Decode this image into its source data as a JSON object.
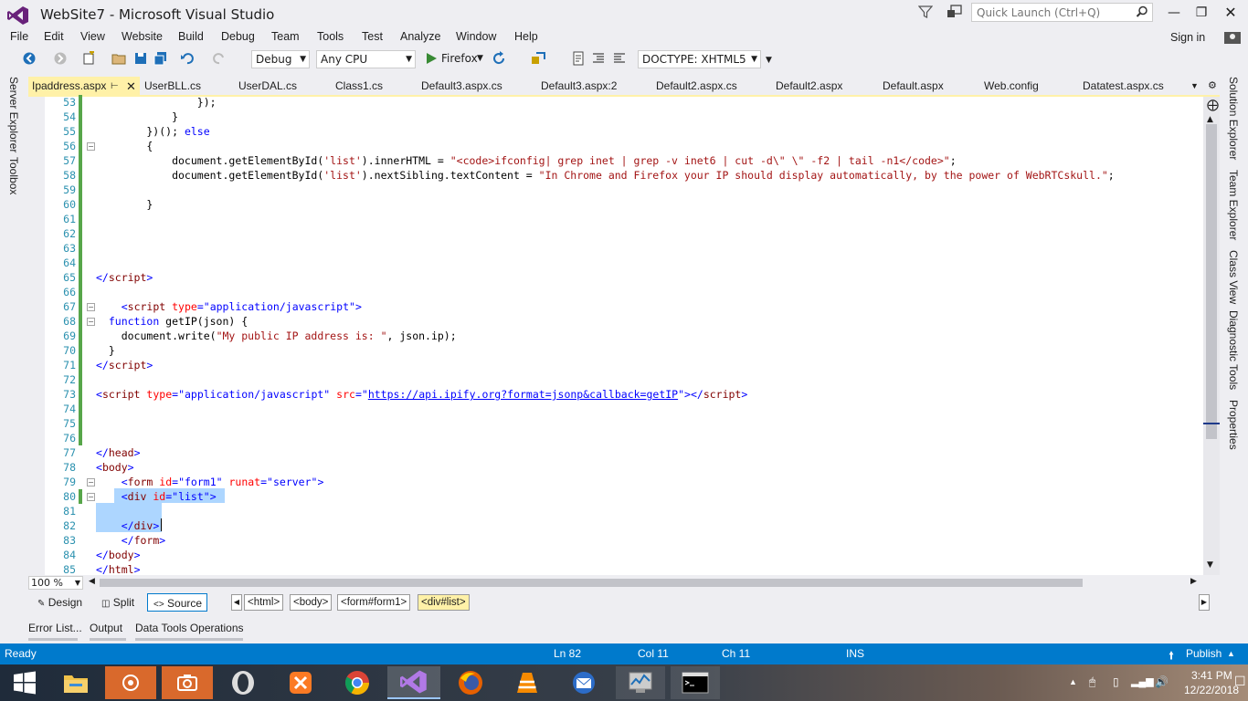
{
  "window": {
    "title": "WebSite7 - Microsoft Visual Studio"
  },
  "quick_launch": {
    "placeholder": "Quick Launch (Ctrl+Q)"
  },
  "menu": {
    "items": [
      "File",
      "Edit",
      "View",
      "Website",
      "Build",
      "Debug",
      "Team",
      "Tools",
      "Test",
      "Analyze",
      "Window",
      "Help"
    ],
    "sign_in": "Sign in"
  },
  "toolbar": {
    "config": "Debug",
    "platform": "Any CPU",
    "run_target": "Firefox",
    "doctype": "DOCTYPE: XHTML5"
  },
  "left_rail": [
    "Server Explorer",
    "Toolbox"
  ],
  "right_rail": [
    "Solution Explorer",
    "Team Explorer",
    "Class View",
    "Diagnostic Tools",
    "Properties"
  ],
  "tabs": [
    "Ipaddress.aspx",
    "UserBLL.cs",
    "UserDAL.cs",
    "Class1.cs",
    "Default3.aspx.cs",
    "Default3.aspx:2",
    "Default2.aspx.cs",
    "Default2.aspx",
    "Default.aspx",
    "Web.config",
    "Datatest.aspx.cs"
  ],
  "code_lines": [
    {
      "n": "53",
      "parts": [
        [
          "",
          "                });"
        ]
      ]
    },
    {
      "n": "54",
      "parts": [
        [
          "",
          "            }"
        ]
      ]
    },
    {
      "n": "55",
      "parts": [
        [
          "",
          "        })(); "
        ],
        [
          "k",
          "else"
        ]
      ]
    },
    {
      "n": "56",
      "parts": [
        [
          "",
          "        {"
        ]
      ]
    },
    {
      "n": "57",
      "parts": [
        [
          "",
          "            document.getElementById("
        ],
        [
          "s",
          "'list'"
        ],
        [
          "",
          ").innerHTML = "
        ],
        [
          "s",
          "\"<code>ifconfig| grep inet | grep -v inet6 | cut -d\\\" \\\" -f2 | tail -n1</code>\""
        ],
        [
          "",
          ";"
        ]
      ]
    },
    {
      "n": "58",
      "parts": [
        [
          "",
          "            document.getElementById("
        ],
        [
          "s",
          "'list'"
        ],
        [
          "",
          ").nextSibling.textContent = "
        ],
        [
          "s",
          "\"In Chrome and Firefox your IP should display automatically, by the power of WebRTCskull.\""
        ],
        [
          "",
          ";"
        ]
      ]
    },
    {
      "n": "59",
      "parts": [
        [
          "",
          ""
        ]
      ]
    },
    {
      "n": "60",
      "parts": [
        [
          "",
          "        }"
        ]
      ]
    },
    {
      "n": "61",
      "parts": [
        [
          "",
          ""
        ]
      ]
    },
    {
      "n": "62",
      "parts": [
        [
          "",
          ""
        ]
      ]
    },
    {
      "n": "63",
      "parts": [
        [
          "",
          ""
        ]
      ]
    },
    {
      "n": "64",
      "parts": [
        [
          "",
          ""
        ]
      ]
    },
    {
      "n": "65",
      "parts": [
        [
          "k",
          "</"
        ],
        [
          "t",
          "script"
        ],
        [
          "k",
          ">"
        ]
      ]
    },
    {
      "n": "66",
      "parts": [
        [
          "",
          ""
        ]
      ]
    },
    {
      "n": "67",
      "parts": [
        [
          "",
          "    "
        ],
        [
          "k",
          "<"
        ],
        [
          "t",
          "script"
        ],
        [
          "",
          " "
        ],
        [
          "a",
          "type"
        ],
        [
          "k",
          "="
        ],
        [
          "av",
          "\"application/javascript\""
        ],
        [
          "k",
          ">"
        ]
      ]
    },
    {
      "n": "68",
      "parts": [
        [
          "",
          "  "
        ],
        [
          "k",
          "function"
        ],
        [
          "",
          " getIP(json) {"
        ]
      ]
    },
    {
      "n": "69",
      "parts": [
        [
          "",
          "    document.write("
        ],
        [
          "s",
          "\"My public IP address is: \""
        ],
        [
          "",
          ", json.ip);"
        ]
      ]
    },
    {
      "n": "70",
      "parts": [
        [
          "",
          "  }"
        ]
      ]
    },
    {
      "n": "71",
      "parts": [
        [
          "k",
          "</"
        ],
        [
          "t",
          "script"
        ],
        [
          "k",
          ">"
        ]
      ]
    },
    {
      "n": "72",
      "parts": [
        [
          "",
          ""
        ]
      ]
    },
    {
      "n": "73",
      "parts": [
        [
          "k",
          "<"
        ],
        [
          "t",
          "script"
        ],
        [
          "",
          " "
        ],
        [
          "a",
          "type"
        ],
        [
          "k",
          "="
        ],
        [
          "av",
          "\"application/javascript\""
        ],
        [
          "",
          " "
        ],
        [
          "a",
          "src"
        ],
        [
          "k",
          "="
        ],
        [
          "av",
          "\""
        ],
        [
          "u",
          "https://api.ipify.org?format=jsonp&callback=getIP"
        ],
        [
          "av",
          "\""
        ],
        [
          "k",
          "></"
        ],
        [
          "t",
          "script"
        ],
        [
          "k",
          ">"
        ]
      ]
    },
    {
      "n": "74",
      "parts": [
        [
          "",
          ""
        ]
      ]
    },
    {
      "n": "75",
      "parts": [
        [
          "",
          ""
        ]
      ]
    },
    {
      "n": "76",
      "parts": [
        [
          "",
          ""
        ]
      ]
    },
    {
      "n": "77",
      "parts": [
        [
          "k",
          "</"
        ],
        [
          "t",
          "head"
        ],
        [
          "k",
          ">"
        ]
      ]
    },
    {
      "n": "78",
      "parts": [
        [
          "k",
          "<"
        ],
        [
          "t",
          "body"
        ],
        [
          "k",
          ">"
        ]
      ]
    },
    {
      "n": "79",
      "parts": [
        [
          "",
          "    "
        ],
        [
          "k",
          "<"
        ],
        [
          "t",
          "form"
        ],
        [
          "",
          " "
        ],
        [
          "a",
          "id"
        ],
        [
          "k",
          "="
        ],
        [
          "av",
          "\"form1\""
        ],
        [
          "",
          " "
        ],
        [
          "a",
          "runat"
        ],
        [
          "k",
          "="
        ],
        [
          "av",
          "\"server\""
        ],
        [
          "k",
          ">"
        ]
      ]
    },
    {
      "n": "80",
      "parts": [
        [
          "",
          "    "
        ],
        [
          "k",
          "<"
        ],
        [
          "t",
          "div"
        ],
        [
          "",
          " "
        ],
        [
          "a",
          "id"
        ],
        [
          "k",
          "="
        ],
        [
          "av",
          "\"list\""
        ],
        [
          "k",
          ">"
        ]
      ]
    },
    {
      "n": "81",
      "parts": [
        [
          "",
          ""
        ]
      ]
    },
    {
      "n": "82",
      "parts": [
        [
          "",
          "    "
        ],
        [
          "k",
          "</"
        ],
        [
          "t",
          "div"
        ],
        [
          "k",
          ">"
        ]
      ]
    },
    {
      "n": "83",
      "parts": [
        [
          "",
          "    "
        ],
        [
          "k",
          "</"
        ],
        [
          "t",
          "form"
        ],
        [
          "k",
          ">"
        ]
      ]
    },
    {
      "n": "84",
      "parts": [
        [
          "k",
          "</"
        ],
        [
          "t",
          "body"
        ],
        [
          "k",
          ">"
        ]
      ]
    },
    {
      "n": "85",
      "parts": [
        [
          "k",
          "</"
        ],
        [
          "t",
          "html"
        ],
        [
          "k",
          ">"
        ]
      ]
    }
  ],
  "editor": {
    "zoom": "100 %"
  },
  "view_tabs": {
    "design": "Design",
    "split": "Split",
    "source": "Source"
  },
  "breadcrumbs": [
    "<html>",
    "<body>",
    "<form#form1>",
    "<div#list>"
  ],
  "lower_tabs": [
    "Error List...",
    "Output",
    "Data Tools Operations"
  ],
  "status": {
    "ready": "Ready",
    "ln": "Ln 82",
    "col": "Col 11",
    "ch": "Ch 11",
    "ins": "INS",
    "publish": "Publish"
  },
  "clock": {
    "time": "3:41 PM",
    "date": "12/22/2018"
  },
  "colors": {
    "accent": "#007acc",
    "active_tab": "#fff1a8",
    "selection": "#add6ff"
  }
}
